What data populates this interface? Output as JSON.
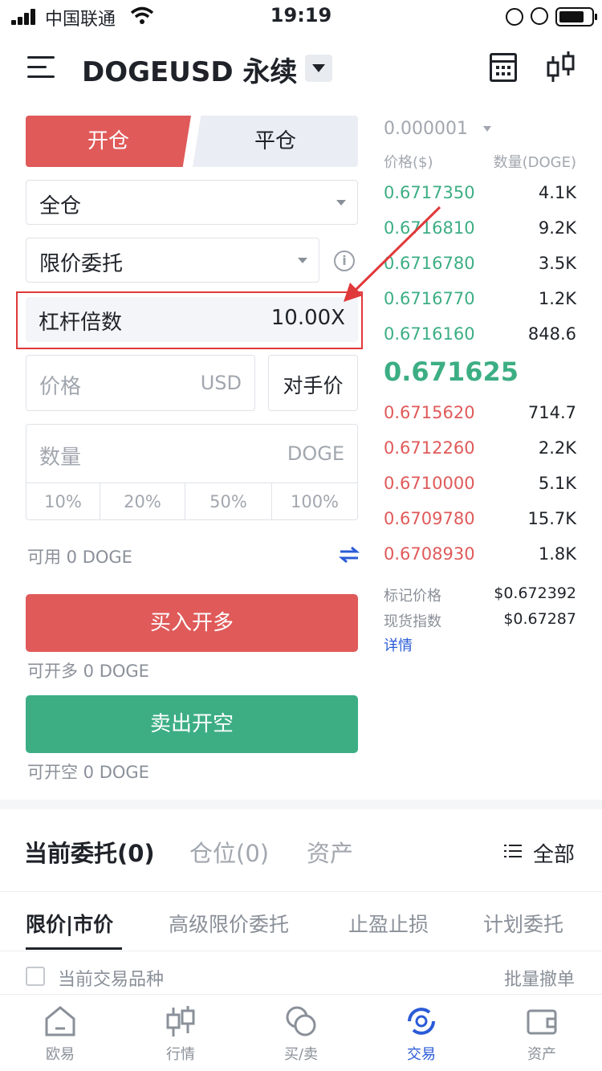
{
  "status_bar": {
    "carrier": "中国联通",
    "time": "19:19"
  },
  "header": {
    "title": "DOGEUSD 永续"
  },
  "trade_form": {
    "tabs": {
      "open": "开仓",
      "close": "平仓"
    },
    "margin_mode": "全仓",
    "order_type": "限价委托",
    "leverage_label": "杠杆倍数",
    "leverage_value": "10.00X",
    "price_placeholder": "价格",
    "price_unit": "USD",
    "counterparty_price_button": "对手价",
    "quantity_placeholder": "数量",
    "quantity_unit": "DOGE",
    "percent_options": [
      "10%",
      "20%",
      "50%",
      "100%"
    ],
    "available": "可用  0 DOGE",
    "buy_button": "买入开多",
    "can_open_long": "可开多  0 DOGE",
    "sell_button": "卖出开空",
    "can_open_short": "可开空  0 DOGE"
  },
  "order_book": {
    "precision": "0.000001",
    "header_price": "价格($)",
    "header_qty": "数量(DOGE)",
    "asks": [
      {
        "price": "0.6717350",
        "qty": "4.1K"
      },
      {
        "price": "0.6716810",
        "qty": "9.2K"
      },
      {
        "price": "0.6716780",
        "qty": "3.5K"
      },
      {
        "price": "0.6716770",
        "qty": "1.2K"
      },
      {
        "price": "0.6716160",
        "qty": "848.6"
      }
    ],
    "last_price": "0.671625",
    "bids": [
      {
        "price": "0.6715620",
        "qty": "714.7"
      },
      {
        "price": "0.6712260",
        "qty": "2.2K"
      },
      {
        "price": "0.6710000",
        "qty": "5.1K"
      },
      {
        "price": "0.6709780",
        "qty": "15.7K"
      },
      {
        "price": "0.6708930",
        "qty": "1.8K"
      }
    ],
    "mark_price_label": "标记价格",
    "mark_price_value": "$0.672392",
    "spot_index_label": "现货指数",
    "spot_index_value": "$0.67287",
    "details_link": "详情"
  },
  "orders_section": {
    "tabs": [
      "当前委托(0)",
      "仓位(0)",
      "资产"
    ],
    "filter": "全部",
    "subtabs": [
      "限价|市价",
      "高级限价委托",
      "止盈止损",
      "计划委托"
    ],
    "current_symbol_checkbox": "当前交易品种",
    "batch_cancel": "批量撤单"
  },
  "bottom_nav": {
    "items": [
      "欧易",
      "行情",
      "买/卖",
      "交易",
      "资产"
    ],
    "active": "交易"
  },
  "colors": {
    "buy_red": "#e05a5a",
    "sell_green": "#3dae84",
    "link_blue": "#2a5bd7",
    "annotation_red": "#e0393b"
  }
}
